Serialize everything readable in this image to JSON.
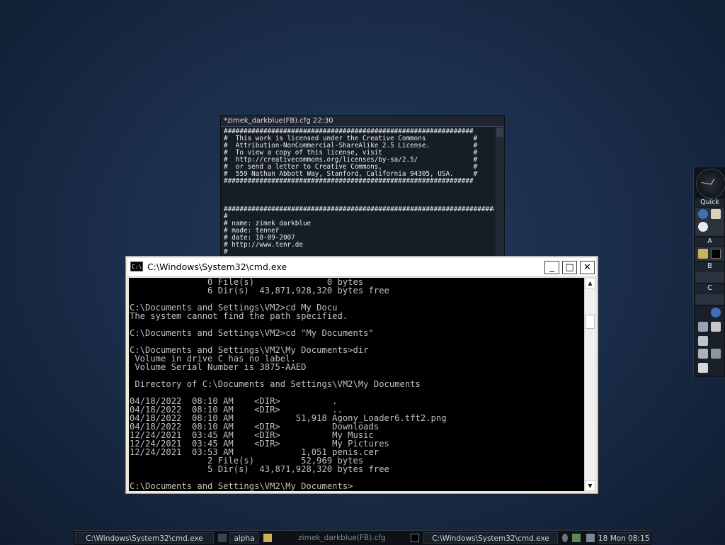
{
  "cfg_window": {
    "title": "*zimek_darkblue(FB).cfg  22:30",
    "lines": [
      "###############################################################",
      "#  This work is licensed under the Creative Commons            #",
      "#  Attribution-NonCommercial-ShareAlike 2.5 License.           #",
      "#  To view a copy of this license, visit                       #",
      "#  http://creativecommons.org/licenses/by-sa/2.5/              #",
      "#  or send a letter to Creative Commons,                       #",
      "#  559 Nathan Abbott Way, Stanford, California 94305, USA.     #",
      "###############################################################",
      "",
      "",
      "",
      "#############################################################################",
      "#",
      "# name: zimek_darkblue",
      "# made: tenner",
      "# date: 18-09-2007",
      "# http://www.tenr.de",
      "#"
    ]
  },
  "cmd_window": {
    "title": "C:\\Windows\\System32\\cmd.exe",
    "buttons": {
      "minimize": "_",
      "maximize": "□",
      "close": "✕"
    },
    "console_lines": [
      "               0 File(s)              0 bytes",
      "               6 Dir(s)  43,871,928,320 bytes free",
      "",
      "C:\\Documents and Settings\\VM2>cd My Docu",
      "The system cannot find the path specified.",
      "",
      "C:\\Documents and Settings\\VM2>cd \"My Documents\"",
      "",
      "C:\\Documents and Settings\\VM2\\My Documents>dir",
      " Volume in drive C has no label.",
      " Volume Serial Number is 3875-AAED",
      "",
      " Directory of C:\\Documents and Settings\\VM2\\My Documents",
      "",
      "04/18/2022  08:10 AM    <DIR>          .",
      "04/18/2022  08:10 AM    <DIR>          ..",
      "04/18/2022  08:10 AM            51,918 Agony_Loader6.tft2.png",
      "04/18/2022  08:10 AM    <DIR>          Downloads",
      "12/24/2021  03:45 AM    <DIR>          My Music",
      "12/24/2021  03:45 AM    <DIR>          My Pictures",
      "12/24/2021  03:53 AM             1,051 penis.cer",
      "               2 File(s)         52,969 bytes",
      "               5 Dir(s)  43,871,928,320 bytes free",
      "",
      "C:\\Documents and Settings\\VM2\\My Documents>"
    ]
  },
  "dock": {
    "quick_label": "Quick",
    "section_a": "A",
    "section_b": "B",
    "section_c": "C",
    "icons": [
      "ie-icon",
      "folder-icon",
      "media-player-icon",
      "image-app-icon",
      "console-icon",
      "ie-icon-2",
      "game-icon",
      "trash-icon",
      "printer-icon",
      "network-icon",
      "tools-icon",
      "recycle-icon"
    ]
  },
  "taskbar": {
    "tasks": [
      {
        "label": "C:\\Windows\\System32\\cmd.exe",
        "active": false
      },
      {
        "label": "alpha",
        "active": false
      },
      {
        "label": "zimek_darkblue(FB).cfg",
        "active": false
      },
      {
        "label": "C:\\Windows\\System32\\cmd.exe",
        "active": true
      }
    ],
    "clock": "18 Mon 08:15"
  },
  "colors": {
    "desktop": "#1b2e4b",
    "console_bg": "#000000",
    "console_fg": "#c0c0c0"
  }
}
